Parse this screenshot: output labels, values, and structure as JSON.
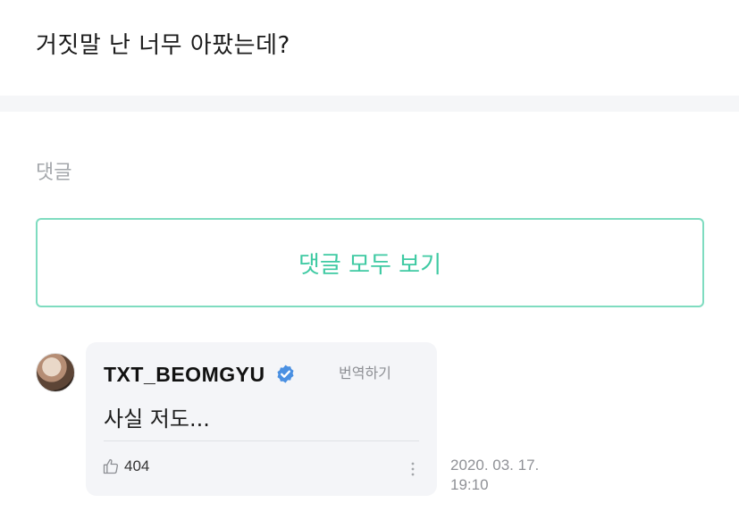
{
  "post": {
    "text": "거짓말 난 너무 아팠는데?"
  },
  "comments_section": {
    "label": "댓글",
    "view_all_label": "댓글 모두 보기"
  },
  "comment": {
    "author": "TXT_BEOMGYU",
    "verified": true,
    "translate_label": "번역하기",
    "body": "사실 저도...",
    "likes": "404",
    "date": "2020. 03. 17.",
    "time": "19:10"
  },
  "colors": {
    "accent": "#3fcaa3",
    "verified": "#4a90e2",
    "bubble_bg": "#f4f5f8"
  },
  "icons": {
    "verified": "verified-badge-icon",
    "like": "thumbs-up-icon",
    "more": "more-vertical-icon"
  }
}
